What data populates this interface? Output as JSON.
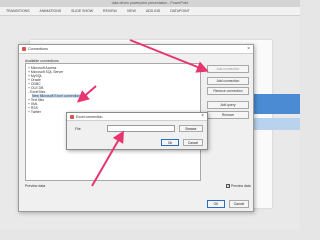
{
  "window": {
    "title": "data driven powerpoint presentation - PowerPoint"
  },
  "ribbon": {
    "tabs": [
      "TRANSITIONS",
      "ANIMATIONS",
      "SLIDE SHOW",
      "REVIEW",
      "VIEW",
      "ADD-INS",
      "DATAPOINT"
    ]
  },
  "dialog": {
    "title": "Connections",
    "available_label": "Available connections",
    "connections": [
      {
        "label": "+ Microsoft Access",
        "level": 0
      },
      {
        "label": "+ Microsoft SQL Server",
        "level": 0
      },
      {
        "label": "+ MySQL",
        "level": 0
      },
      {
        "label": "+ Oracle",
        "level": 0
      },
      {
        "label": "+ ODBC",
        "level": 0
      },
      {
        "label": "+ OLE DB",
        "level": 0
      },
      {
        "label": "- Excel files",
        "level": 0
      },
      {
        "label": "New Microsoft Excel connection",
        "level": 1
      },
      {
        "label": "+ Text files",
        "level": 0
      },
      {
        "label": "+ XML",
        "level": 0
      },
      {
        "label": "+ RSS",
        "level": 0
      },
      {
        "label": "+ Twitter",
        "level": 0
      }
    ],
    "buttons": {
      "top": "Add connection",
      "add_connection": "Add connection",
      "remove_connection": "Remove connection",
      "add_query": "Add query",
      "remove": "Remove"
    },
    "preview_label": "Preview data",
    "preview_check_label": "Preview data",
    "ok": "OK",
    "cancel": "Cancel"
  },
  "excel_dialog": {
    "title": "Excel connection",
    "file_label": "File",
    "file_value": "",
    "browse": "Browse",
    "ok": "Ok",
    "cancel": "Cancel"
  },
  "colors": {
    "arrow": "#e8356f",
    "selection": "#cfe3f8",
    "accent": "#4a8bd4"
  }
}
